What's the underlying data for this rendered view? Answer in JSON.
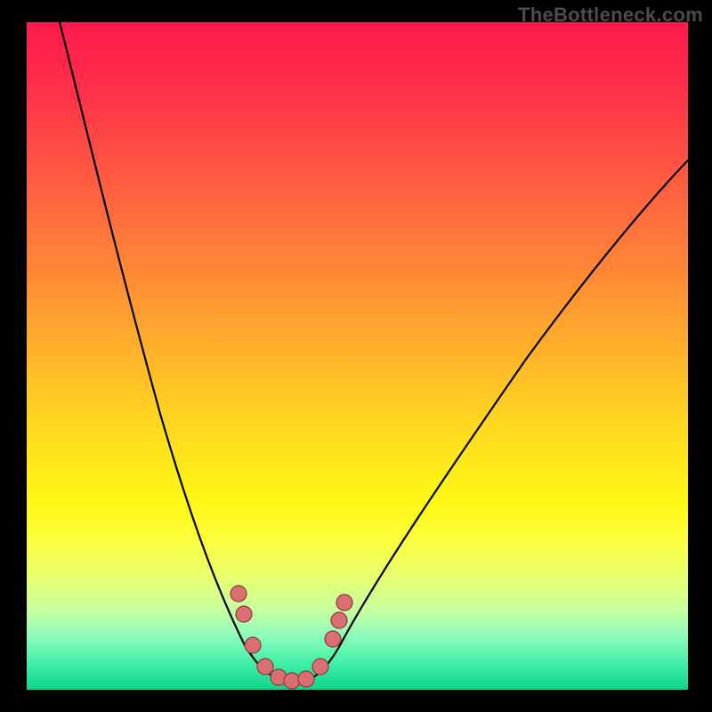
{
  "watermark": "TheBottleneck.com",
  "colors": {
    "frame": "#000000",
    "curve": "#000000",
    "marker_fill": "#d96f70",
    "marker_stroke": "#8b3a3a",
    "watermark": "#4c4c4c"
  },
  "chart_data": {
    "type": "line",
    "title": "",
    "xlabel": "",
    "ylabel": "",
    "xlim": [
      0,
      100
    ],
    "ylim": [
      0,
      100
    ],
    "grid": false,
    "legend": false,
    "series": [
      {
        "name": "bottleneck-curve",
        "x": [
          5,
          10,
          15,
          20,
          24,
          27,
          30,
          32,
          34,
          36,
          38,
          40,
          42,
          44,
          46,
          50,
          55,
          60,
          65,
          70,
          75,
          80,
          85,
          90,
          95,
          100
        ],
        "values": [
          100,
          84,
          68,
          52,
          38,
          27,
          18,
          12,
          8,
          5,
          3,
          2,
          2,
          3,
          5,
          10,
          18,
          26,
          34,
          42,
          50,
          57,
          63,
          68,
          72,
          75
        ]
      }
    ],
    "markers": {
      "name": "highlighted-points",
      "x": [
        32,
        33,
        35,
        37,
        39,
        41,
        43,
        45,
        46,
        47
      ],
      "values": [
        15,
        11,
        6,
        3,
        2,
        2,
        2,
        4,
        7,
        10
      ]
    },
    "gradient_stops_pct": {
      "red": 0,
      "orange": 40,
      "yellow": 70,
      "green": 100
    }
  }
}
